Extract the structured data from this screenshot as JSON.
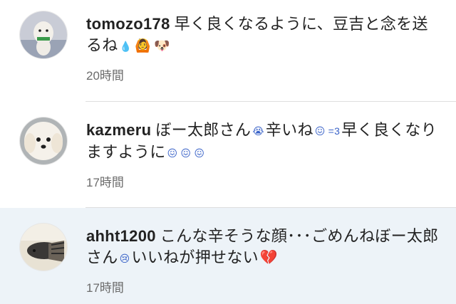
{
  "comments": [
    {
      "username": "tomozo178",
      "text": "早く良くなるように、豆吉と念を送るね",
      "emoji": [
        "💧",
        "🙆",
        "🐶"
      ],
      "time": "20時間"
    },
    {
      "username": "kazmeru",
      "text_a": "ぼー太郎さん",
      "text_b": "辛いね",
      "text_c": "早く良くなりますように",
      "emoji": [
        "😭",
        "😖",
        "=3",
        "😖",
        "😖",
        "😖"
      ],
      "time": "17時間"
    },
    {
      "username": "ahht1200",
      "text_a": "こんな辛そうな顔･･･ごめんねぼー太郎さん",
      "text_b": "いいねが押せない",
      "emoji": [
        "😢",
        "💔"
      ],
      "time": "17時間"
    }
  ],
  "colors": {
    "highlight_bg": "#edf3f8",
    "text": "#222222",
    "time": "#6b6b6b",
    "heart": "#d0102c"
  }
}
